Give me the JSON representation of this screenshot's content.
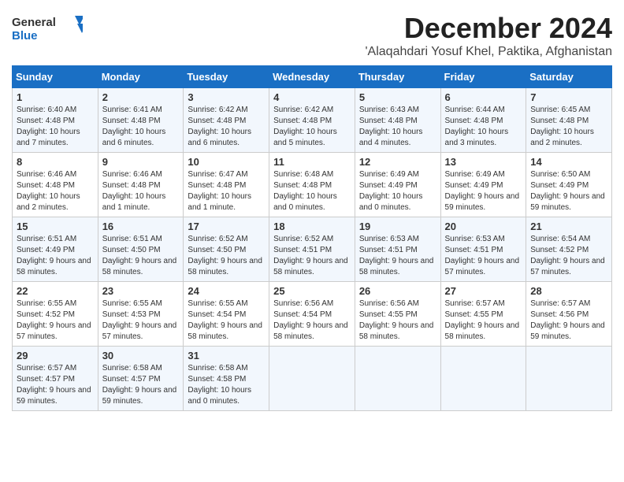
{
  "logo": {
    "line1": "General",
    "line2": "Blue"
  },
  "title": "December 2024",
  "location": "'Alaqahdari Yosuf Khel, Paktika, Afghanistan",
  "days_of_week": [
    "Sunday",
    "Monday",
    "Tuesday",
    "Wednesday",
    "Thursday",
    "Friday",
    "Saturday"
  ],
  "weeks": [
    [
      {
        "day": "1",
        "sunrise": "6:40 AM",
        "sunset": "4:48 PM",
        "daylight": "10 hours and 7 minutes."
      },
      {
        "day": "2",
        "sunrise": "6:41 AM",
        "sunset": "4:48 PM",
        "daylight": "10 hours and 6 minutes."
      },
      {
        "day": "3",
        "sunrise": "6:42 AM",
        "sunset": "4:48 PM",
        "daylight": "10 hours and 6 minutes."
      },
      {
        "day": "4",
        "sunrise": "6:42 AM",
        "sunset": "4:48 PM",
        "daylight": "10 hours and 5 minutes."
      },
      {
        "day": "5",
        "sunrise": "6:43 AM",
        "sunset": "4:48 PM",
        "daylight": "10 hours and 4 minutes."
      },
      {
        "day": "6",
        "sunrise": "6:44 AM",
        "sunset": "4:48 PM",
        "daylight": "10 hours and 3 minutes."
      },
      {
        "day": "7",
        "sunrise": "6:45 AM",
        "sunset": "4:48 PM",
        "daylight": "10 hours and 2 minutes."
      }
    ],
    [
      {
        "day": "8",
        "sunrise": "6:46 AM",
        "sunset": "4:48 PM",
        "daylight": "10 hours and 2 minutes."
      },
      {
        "day": "9",
        "sunrise": "6:46 AM",
        "sunset": "4:48 PM",
        "daylight": "10 hours and 1 minute."
      },
      {
        "day": "10",
        "sunrise": "6:47 AM",
        "sunset": "4:48 PM",
        "daylight": "10 hours and 1 minute."
      },
      {
        "day": "11",
        "sunrise": "6:48 AM",
        "sunset": "4:48 PM",
        "daylight": "10 hours and 0 minutes."
      },
      {
        "day": "12",
        "sunrise": "6:49 AM",
        "sunset": "4:49 PM",
        "daylight": "10 hours and 0 minutes."
      },
      {
        "day": "13",
        "sunrise": "6:49 AM",
        "sunset": "4:49 PM",
        "daylight": "9 hours and 59 minutes."
      },
      {
        "day": "14",
        "sunrise": "6:50 AM",
        "sunset": "4:49 PM",
        "daylight": "9 hours and 59 minutes."
      }
    ],
    [
      {
        "day": "15",
        "sunrise": "6:51 AM",
        "sunset": "4:49 PM",
        "daylight": "9 hours and 58 minutes."
      },
      {
        "day": "16",
        "sunrise": "6:51 AM",
        "sunset": "4:50 PM",
        "daylight": "9 hours and 58 minutes."
      },
      {
        "day": "17",
        "sunrise": "6:52 AM",
        "sunset": "4:50 PM",
        "daylight": "9 hours and 58 minutes."
      },
      {
        "day": "18",
        "sunrise": "6:52 AM",
        "sunset": "4:51 PM",
        "daylight": "9 hours and 58 minutes."
      },
      {
        "day": "19",
        "sunrise": "6:53 AM",
        "sunset": "4:51 PM",
        "daylight": "9 hours and 58 minutes."
      },
      {
        "day": "20",
        "sunrise": "6:53 AM",
        "sunset": "4:51 PM",
        "daylight": "9 hours and 57 minutes."
      },
      {
        "day": "21",
        "sunrise": "6:54 AM",
        "sunset": "4:52 PM",
        "daylight": "9 hours and 57 minutes."
      }
    ],
    [
      {
        "day": "22",
        "sunrise": "6:55 AM",
        "sunset": "4:52 PM",
        "daylight": "9 hours and 57 minutes."
      },
      {
        "day": "23",
        "sunrise": "6:55 AM",
        "sunset": "4:53 PM",
        "daylight": "9 hours and 57 minutes."
      },
      {
        "day": "24",
        "sunrise": "6:55 AM",
        "sunset": "4:54 PM",
        "daylight": "9 hours and 58 minutes."
      },
      {
        "day": "25",
        "sunrise": "6:56 AM",
        "sunset": "4:54 PM",
        "daylight": "9 hours and 58 minutes."
      },
      {
        "day": "26",
        "sunrise": "6:56 AM",
        "sunset": "4:55 PM",
        "daylight": "9 hours and 58 minutes."
      },
      {
        "day": "27",
        "sunrise": "6:57 AM",
        "sunset": "4:55 PM",
        "daylight": "9 hours and 58 minutes."
      },
      {
        "day": "28",
        "sunrise": "6:57 AM",
        "sunset": "4:56 PM",
        "daylight": "9 hours and 59 minutes."
      }
    ],
    [
      {
        "day": "29",
        "sunrise": "6:57 AM",
        "sunset": "4:57 PM",
        "daylight": "9 hours and 59 minutes."
      },
      {
        "day": "30",
        "sunrise": "6:58 AM",
        "sunset": "4:57 PM",
        "daylight": "9 hours and 59 minutes."
      },
      {
        "day": "31",
        "sunrise": "6:58 AM",
        "sunset": "4:58 PM",
        "daylight": "10 hours and 0 minutes."
      },
      null,
      null,
      null,
      null
    ]
  ],
  "labels": {
    "sunrise": "Sunrise:",
    "sunset": "Sunset:",
    "daylight": "Daylight:"
  }
}
